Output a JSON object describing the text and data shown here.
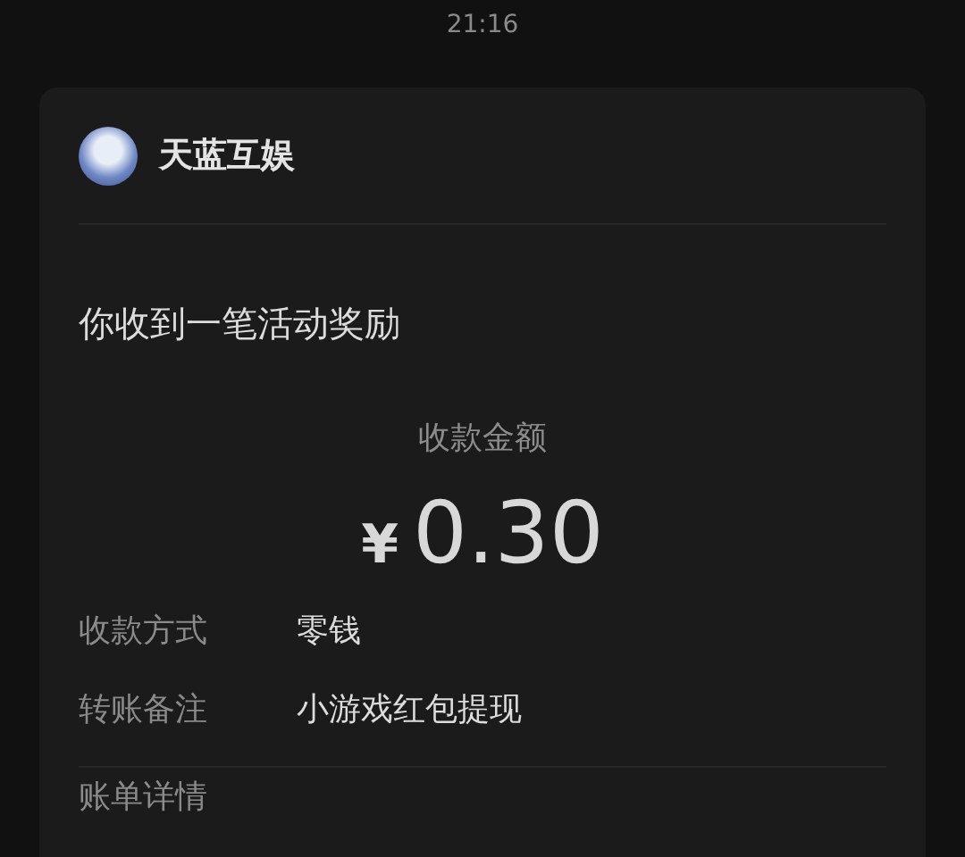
{
  "time": "21:16",
  "sender": {
    "name": "天蓝互娱"
  },
  "message": {
    "title": "你收到一笔活动奖励",
    "amount_label": "收款金额",
    "currency": "¥",
    "amount": "0.30"
  },
  "details": [
    {
      "label": "收款方式",
      "value": "零钱"
    },
    {
      "label": "转账备注",
      "value": "小游戏红包提现"
    }
  ],
  "footer_link": "账单详情"
}
